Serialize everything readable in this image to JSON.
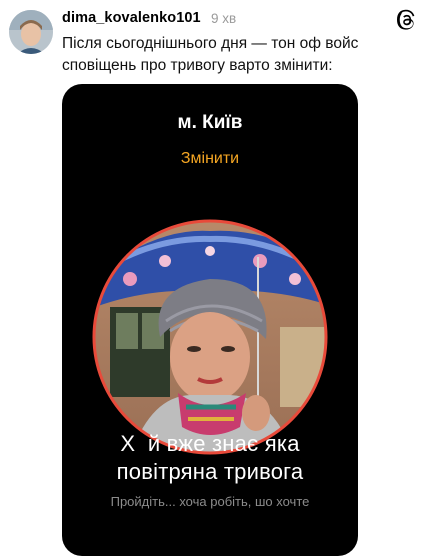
{
  "post": {
    "username": "dima_kovalenko101",
    "time": "9 хв",
    "text": "Після сьогоднішнього дня — тон оф войс сповіщень про тривогу варто змінити:",
    "avatar": "user-avatar",
    "app_icon": "threads-icon"
  },
  "card": {
    "city": "м. Київ",
    "change_label": "Змінити",
    "headline_line1": "Х  й вже знає яка",
    "headline_line2": "повітряна тривога",
    "subtitle": "Пройдіть... хоча робіть, шо хочте",
    "accent_color": "#f5a623",
    "ring_color": "#e84a3a"
  }
}
